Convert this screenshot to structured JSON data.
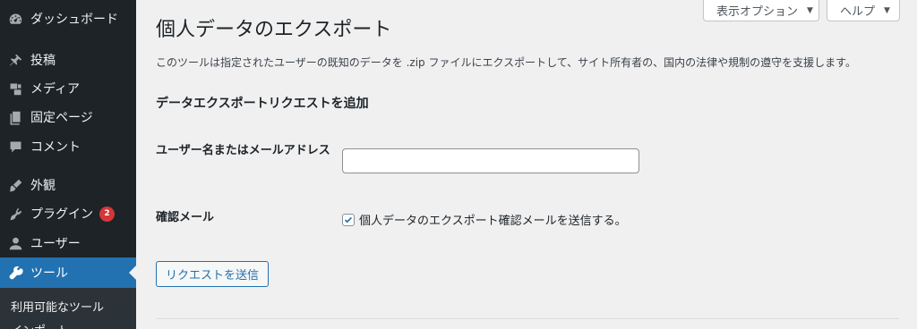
{
  "sidebar": {
    "items": [
      {
        "label": "ダッシュボード",
        "icon": "dashboard-icon"
      },
      {
        "label": "投稿",
        "icon": "pin-icon"
      },
      {
        "label": "メディア",
        "icon": "media-icon"
      },
      {
        "label": "固定ページ",
        "icon": "page-icon"
      },
      {
        "label": "コメント",
        "icon": "comment-icon"
      },
      {
        "label": "外観",
        "icon": "brush-icon"
      },
      {
        "label": "プラグイン",
        "icon": "plugin-icon",
        "badge": "2"
      },
      {
        "label": "ユーザー",
        "icon": "user-icon"
      },
      {
        "label": "ツール",
        "icon": "wrench-icon",
        "current": true
      }
    ],
    "submenu": [
      "利用可能なツール",
      "インポート"
    ]
  },
  "screen_meta": {
    "options_label": "表示オプション",
    "help_label": "ヘルプ"
  },
  "main": {
    "title": "個人データのエクスポート",
    "description": "このツールは指定されたユーザーの既知のデータを .zip ファイルにエクスポートして、サイト所有者の、国内の法律や規制の遵守を支援します。",
    "section_title": "データエクスポートリクエストを追加",
    "username_label": "ユーザー名またはメールアドレス",
    "username_value": "",
    "confirm_label": "確認メール",
    "confirm_checkbox_label": "個人データのエクスポート確認メールを送信する。",
    "confirm_checked": true,
    "submit_label": "リクエストを送信"
  },
  "colors": {
    "sidebar_bg": "#1d2327",
    "accent": "#2271b1",
    "badge": "#d63638",
    "page_bg": "#f0f0f1"
  }
}
